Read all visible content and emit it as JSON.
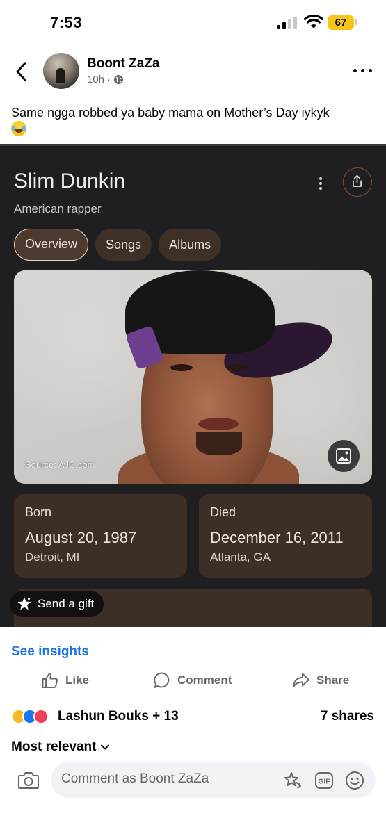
{
  "status_bar": {
    "time": "7:53",
    "battery": "67"
  },
  "post": {
    "author": "Boont ZaZa",
    "time": "10h",
    "separator": "·",
    "caption": "Same ngga robbed ya baby mama on Mother’s Day iykyk"
  },
  "embed": {
    "title": "Slim Dunkin",
    "subtitle": "American rapper",
    "tabs": [
      {
        "label": "Overview",
        "active": true
      },
      {
        "label": "Songs",
        "active": false
      },
      {
        "label": "Albums",
        "active": false
      }
    ],
    "photo_source": "Source: AJC.com",
    "born": {
      "label": "Born",
      "date": "August 20, 1987",
      "place": "Detroit, MI"
    },
    "died": {
      "label": "Died",
      "date": "December 16, 2011",
      "place": "Atlanta, GA"
    },
    "gift_label": "Send a gift",
    "colors": {
      "card": "#3d2e26",
      "background": "#1f1f21"
    }
  },
  "footer": {
    "insights": "See insights",
    "like": "Like",
    "comment": "Comment",
    "share": "Share",
    "reactions_text": "Lashun Bouks + 13",
    "shares": "7 shares",
    "sort": "Most relevant",
    "comment_placeholder": "Comment as Boont ZaZa",
    "accent": "#1b74e4"
  },
  "icons": [
    "back-arrow-icon",
    "globe-icon",
    "more-icon",
    "share-icon",
    "gallery-icon",
    "gift-icon",
    "like-icon",
    "comment-icon",
    "share-arrow-icon",
    "camera-icon",
    "sticker-icon",
    "gif-icon",
    "emoji-icon",
    "chevron-down-icon"
  ]
}
